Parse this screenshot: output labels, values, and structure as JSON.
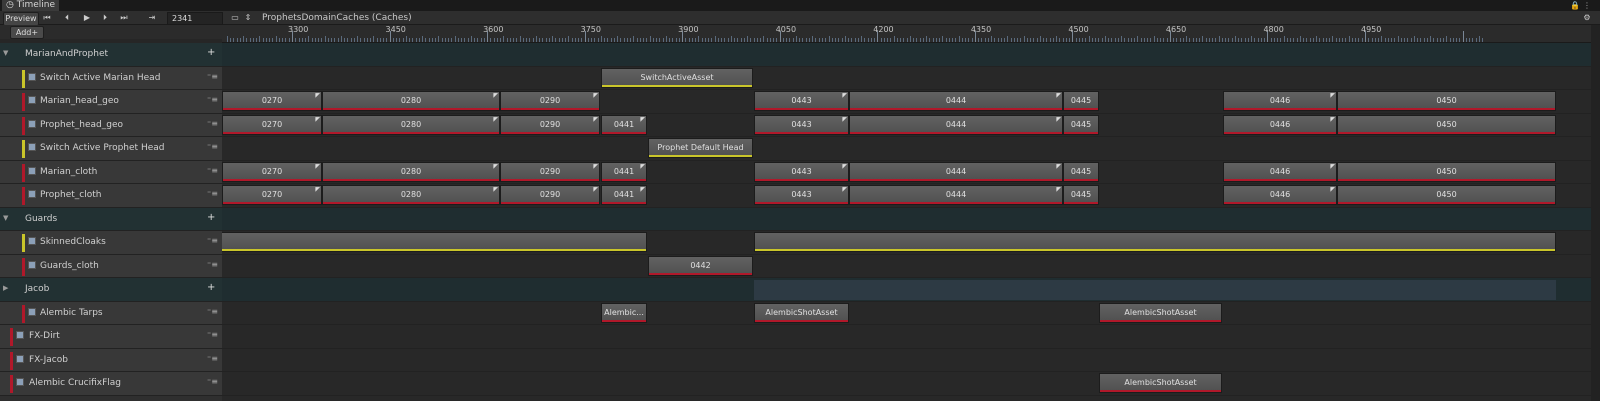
{
  "window": {
    "title": "Timeline"
  },
  "toolbar": {
    "preview_label": "Preview",
    "frame": "2341",
    "asset_name": "ProphetsDomainCaches (Caches)",
    "add_label": "Add+"
  },
  "ruler": {
    "labels": [
      "3300",
      "3450",
      "3600",
      "3750",
      "3900",
      "4050",
      "4200",
      "4350",
      "4500",
      "4650",
      "4800",
      "4950"
    ]
  },
  "colors": {
    "activation": "#c9c52a",
    "cache": "#b0182a",
    "group_bg": "#223133"
  },
  "tracks": [
    {
      "type": "group",
      "label": "MarianAndProphet",
      "collapsed": false,
      "clips": []
    },
    {
      "type": "track",
      "label": "Switch Active Marian Head",
      "accent": "yellow",
      "clips": [
        {
          "label": "SwitchActiveAsset",
          "start": 601,
          "end": 753,
          "bar": "yellow"
        }
      ]
    },
    {
      "type": "track",
      "label": "Marian_head_geo",
      "accent": "red",
      "clips": [
        {
          "label": "0270",
          "start": 222,
          "end": 322,
          "bar": "red",
          "mk": true
        },
        {
          "label": "0280",
          "start": 322,
          "end": 500,
          "bar": "red",
          "mk": true
        },
        {
          "label": "0290",
          "start": 500,
          "end": 600,
          "bar": "red",
          "mk": true
        },
        {
          "label": "0443",
          "start": 754,
          "end": 849,
          "bar": "red",
          "mk": true
        },
        {
          "label": "0444",
          "start": 849,
          "end": 1063,
          "bar": "red",
          "mk": true
        },
        {
          "label": "0445",
          "start": 1063,
          "end": 1099,
          "bar": "red"
        },
        {
          "label": "0446",
          "start": 1223,
          "end": 1337,
          "bar": "red",
          "mk": true
        },
        {
          "label": "0450",
          "start": 1337,
          "end": 1556,
          "bar": "red"
        }
      ]
    },
    {
      "type": "track",
      "label": "Prophet_head_geo",
      "accent": "red",
      "clips": [
        {
          "label": "0270",
          "start": 222,
          "end": 322,
          "bar": "red",
          "mk": true
        },
        {
          "label": "0280",
          "start": 322,
          "end": 500,
          "bar": "red",
          "mk": true
        },
        {
          "label": "0290",
          "start": 500,
          "end": 600,
          "bar": "red",
          "mk": true
        },
        {
          "label": "0441",
          "start": 601,
          "end": 647,
          "bar": "red",
          "mk": true
        },
        {
          "label": "0443",
          "start": 754,
          "end": 849,
          "bar": "red",
          "mk": true
        },
        {
          "label": "0444",
          "start": 849,
          "end": 1063,
          "bar": "red",
          "mk": true
        },
        {
          "label": "0445",
          "start": 1063,
          "end": 1099,
          "bar": "red"
        },
        {
          "label": "0446",
          "start": 1223,
          "end": 1337,
          "bar": "red",
          "mk": true
        },
        {
          "label": "0450",
          "start": 1337,
          "end": 1556,
          "bar": "red"
        }
      ]
    },
    {
      "type": "track",
      "label": "Switch Active Prophet Head",
      "accent": "yellow",
      "clips": [
        {
          "label": "Prophet Default Head",
          "start": 648,
          "end": 753,
          "bar": "yellow"
        }
      ]
    },
    {
      "type": "track",
      "label": "Marian_cloth",
      "accent": "red",
      "clips": [
        {
          "label": "0270",
          "start": 222,
          "end": 322,
          "bar": "red",
          "mk": true
        },
        {
          "label": "0280",
          "start": 322,
          "end": 500,
          "bar": "red",
          "mk": true
        },
        {
          "label": "0290",
          "start": 500,
          "end": 600,
          "bar": "red",
          "mk": true
        },
        {
          "label": "0441",
          "start": 601,
          "end": 647,
          "bar": "red",
          "mk": true
        },
        {
          "label": "0443",
          "start": 754,
          "end": 849,
          "bar": "red",
          "mk": true
        },
        {
          "label": "0444",
          "start": 849,
          "end": 1063,
          "bar": "red",
          "mk": true
        },
        {
          "label": "0445",
          "start": 1063,
          "end": 1099,
          "bar": "red"
        },
        {
          "label": "0446",
          "start": 1223,
          "end": 1337,
          "bar": "red",
          "mk": true
        },
        {
          "label": "0450",
          "start": 1337,
          "end": 1556,
          "bar": "red"
        }
      ]
    },
    {
      "type": "track",
      "label": "Prophet_cloth",
      "accent": "red",
      "clips": [
        {
          "label": "0270",
          "start": 222,
          "end": 322,
          "bar": "red",
          "mk": true
        },
        {
          "label": "0280",
          "start": 322,
          "end": 500,
          "bar": "red",
          "mk": true
        },
        {
          "label": "0290",
          "start": 500,
          "end": 600,
          "bar": "red",
          "mk": true
        },
        {
          "label": "0441",
          "start": 601,
          "end": 647,
          "bar": "red",
          "mk": true
        },
        {
          "label": "0443",
          "start": 754,
          "end": 849,
          "bar": "red",
          "mk": true
        },
        {
          "label": "0444",
          "start": 849,
          "end": 1063,
          "bar": "red",
          "mk": true
        },
        {
          "label": "0445",
          "start": 1063,
          "end": 1099,
          "bar": "red"
        },
        {
          "label": "0446",
          "start": 1223,
          "end": 1337,
          "bar": "red",
          "mk": true
        },
        {
          "label": "0450",
          "start": 1337,
          "end": 1556,
          "bar": "red"
        }
      ]
    },
    {
      "type": "group",
      "label": "Guards",
      "collapsed": false,
      "clips": []
    },
    {
      "type": "track",
      "label": "SkinnedCloaks",
      "accent": "yellow",
      "clips": [
        {
          "label": "",
          "start": 218,
          "end": 647,
          "bar": "yellow"
        },
        {
          "label": "",
          "start": 754,
          "end": 1556,
          "bar": "yellow"
        }
      ]
    },
    {
      "type": "track",
      "label": "Guards_cloth",
      "accent": "red",
      "clips": [
        {
          "label": "0442",
          "start": 648,
          "end": 753,
          "bar": "red"
        }
      ]
    },
    {
      "type": "group",
      "label": "Jacob",
      "collapsed": true,
      "clips": []
    },
    {
      "type": "track",
      "label": "Alembic Tarps",
      "accent": "red",
      "clips": [
        {
          "label": "Alembic...",
          "start": 601,
          "end": 647,
          "bar": "red"
        },
        {
          "label": "AlembicShotAsset",
          "start": 754,
          "end": 849,
          "bar": "red"
        },
        {
          "label": "AlembicShotAsset",
          "start": 1099,
          "end": 1222,
          "bar": "red"
        }
      ]
    },
    {
      "type": "track",
      "label": "FX-Dirt",
      "accent": "red",
      "clips": []
    },
    {
      "type": "track",
      "label": "FX-Jacob",
      "accent": "red",
      "clips": []
    },
    {
      "type": "track",
      "label": "Alembic CrucifixFlag",
      "accent": "red",
      "clips": [
        {
          "label": "AlembicShotAsset",
          "start": 1099,
          "end": 1222,
          "bar": "red"
        }
      ]
    }
  ]
}
